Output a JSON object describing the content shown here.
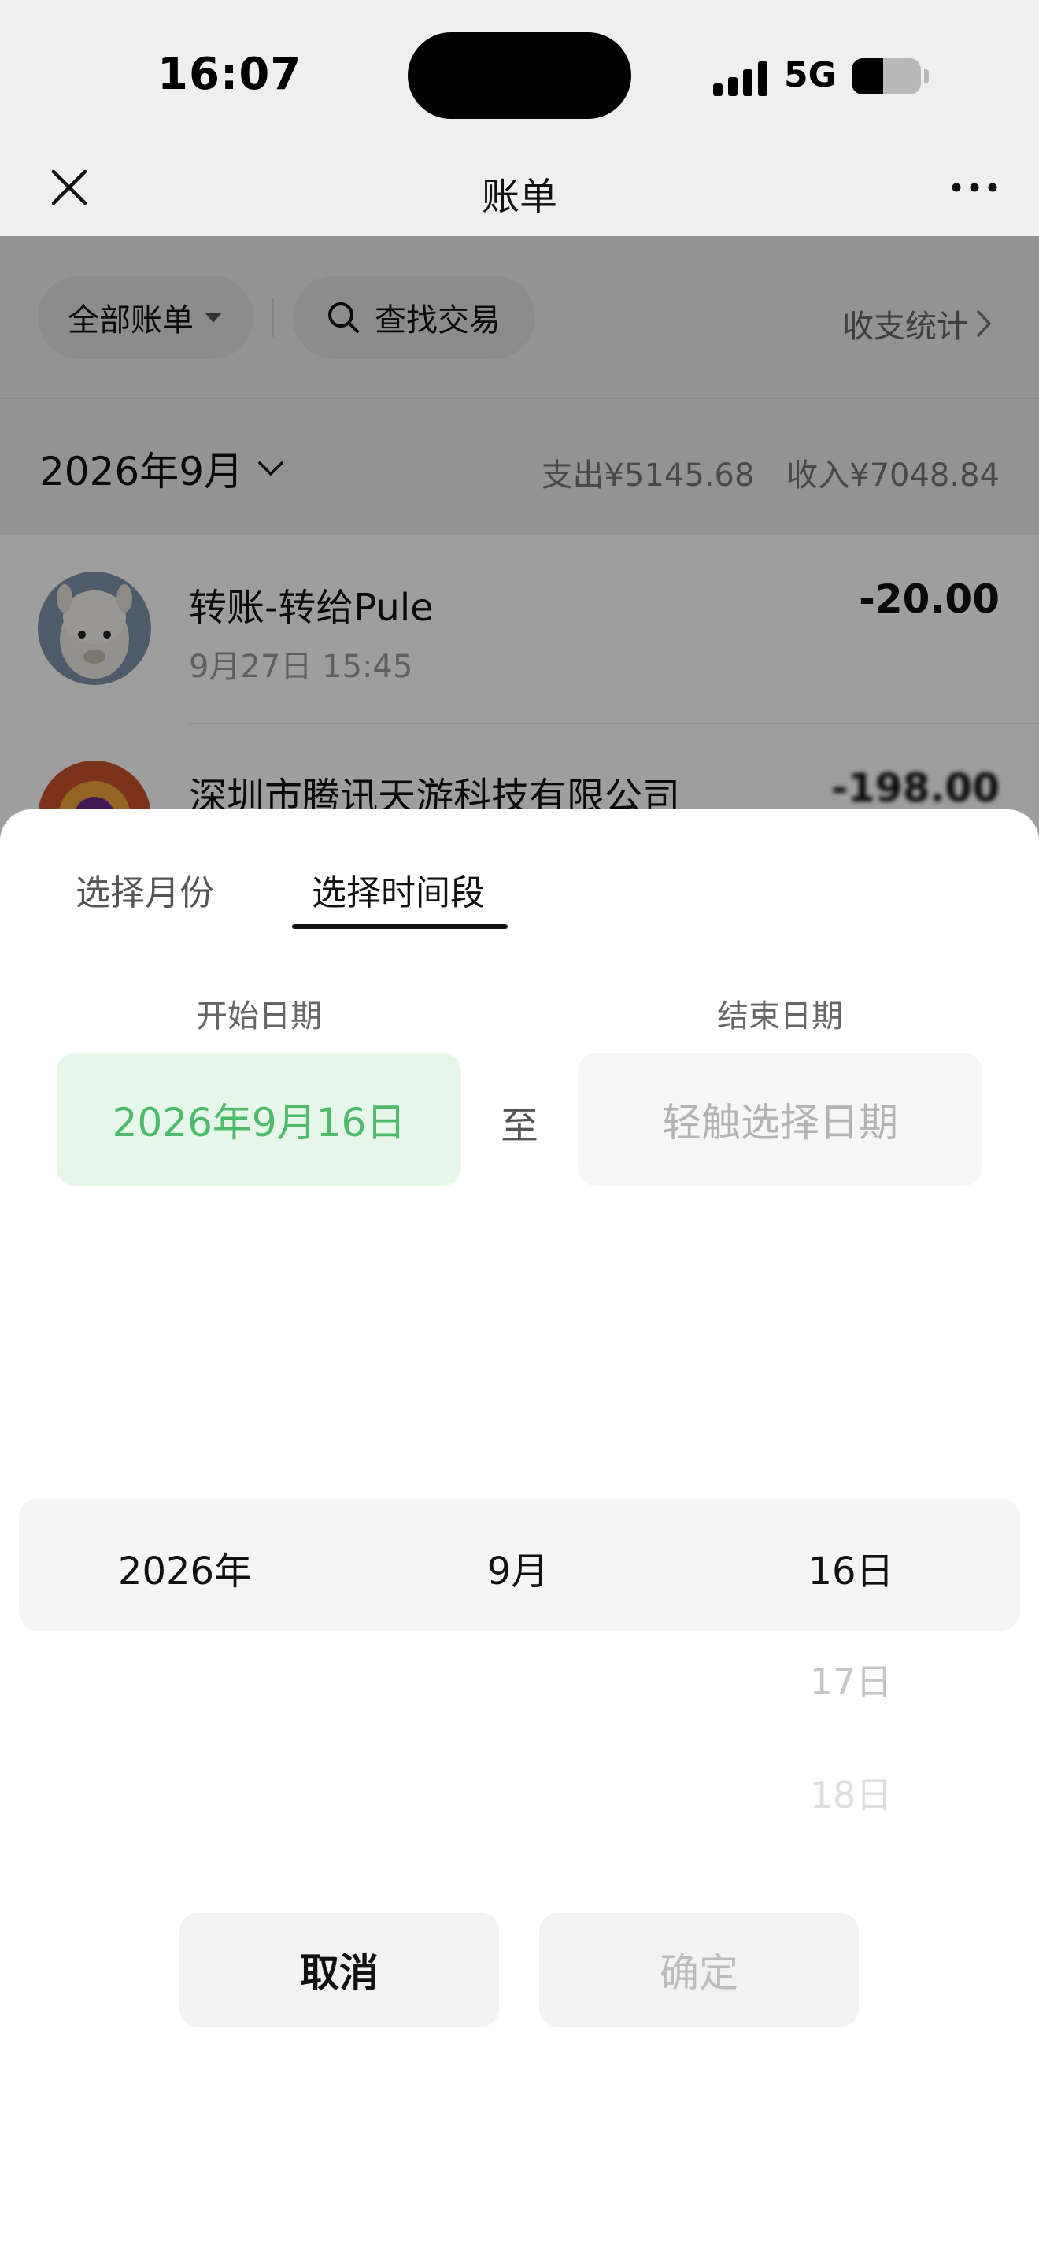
{
  "status_bar": {
    "time": "16:07",
    "network": "5G",
    "battery_level": 0.45
  },
  "nav": {
    "title": "账单",
    "close_icon": "close-icon",
    "more_icon": "more-icon"
  },
  "filters": {
    "all_bills_label": "全部账单",
    "search_label": "查找交易",
    "stats_label": "收支统计"
  },
  "month_header": {
    "month": "2026年9月",
    "expense": "支出¥5145.68",
    "income": "收入¥7048.84"
  },
  "transactions": [
    {
      "name": "转账-转给Pule",
      "time": "9月27日 15:45",
      "amount": "-20.00"
    },
    {
      "name": "深圳市腾讯天游科技有限公司",
      "time": "",
      "amount": "-198.00"
    }
  ],
  "sheet": {
    "tabs": [
      {
        "label": "选择月份",
        "active": false
      },
      {
        "label": "选择时间段",
        "active": true
      }
    ],
    "start_label": "开始日期",
    "end_label": "结束日期",
    "start_value": "2026年9月16日",
    "end_placeholder": "轻触选择日期",
    "to_label": "至",
    "picker": {
      "year": "2026年",
      "month": "9月",
      "day": "16日",
      "next_days": [
        "17日",
        "18日"
      ]
    },
    "cancel_label": "取消",
    "confirm_label": "确定"
  },
  "colors": {
    "accent_green": "#4dbb69",
    "start_box_bg": "#e6f7ea"
  }
}
